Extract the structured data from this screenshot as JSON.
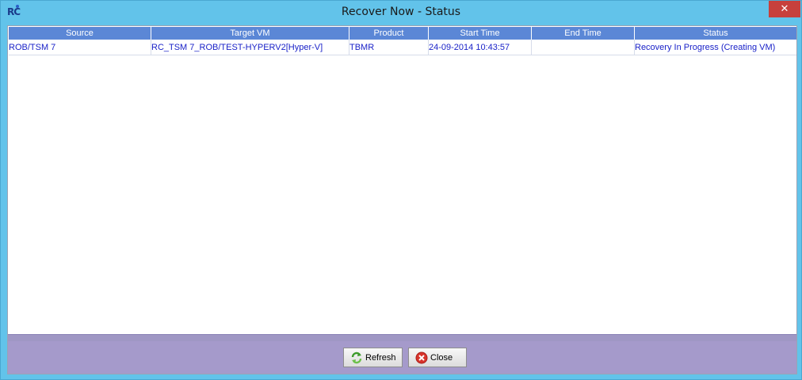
{
  "window": {
    "title": "Recover Now - Status",
    "logo_text": "RC",
    "close_glyph": "✕"
  },
  "table": {
    "columns": [
      "Source",
      "Target VM",
      "Product",
      "Start Time",
      "End Time",
      "Status"
    ],
    "rows": [
      {
        "source": "ROB/TSM 7",
        "target_vm": "RC_TSM 7_ROB/TEST-HYPERV2[Hyper-V]",
        "product": "TBMR",
        "start_time": "24-09-2014 10:43:57",
        "end_time": "",
        "status": "Recovery In Progress (Creating VM)"
      }
    ]
  },
  "footer": {
    "refresh_label": "Refresh",
    "close_label": "Close"
  },
  "icons": {
    "refresh": "refresh-icon",
    "close": "close-circle-icon"
  },
  "colors": {
    "titlebar": "#62c3ea",
    "header": "#5b87d6",
    "row_text": "#1a22c8",
    "footer": "#a59acb",
    "close_button": "#c7403c"
  }
}
